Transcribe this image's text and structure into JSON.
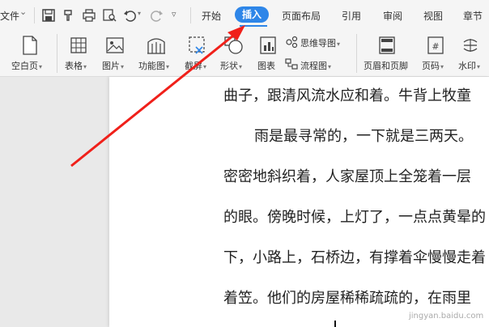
{
  "menu": {
    "file_label": "文件",
    "tabs": [
      {
        "label": "开始"
      },
      {
        "label": "插入"
      },
      {
        "label": "页面布局"
      },
      {
        "label": "引用"
      },
      {
        "label": "审阅"
      },
      {
        "label": "视图"
      },
      {
        "label": "章节"
      }
    ]
  },
  "ribbon": {
    "blank_page": "空白页",
    "table": "表格",
    "picture": "图片",
    "function_chart": "功能图",
    "screenshot": "截屏",
    "shape": "形状",
    "chart": "图表",
    "mindmap": "思维导图",
    "flowchart": "流程图",
    "header_footer": "页眉和页脚",
    "page_number": "页码",
    "watermark": "水印"
  },
  "document": {
    "lines": [
      "曲子，跟清风流水应和着。牛背上牧童",
      "雨是最寻常的，一下就是三两天。",
      "密密地斜织着，人家屋顶上全笼着一层",
      "的眼。傍晚时候，上灯了，一点点黄晕的",
      "下，小路上，石桥边，有撑着伞慢慢走着",
      "着笠。他们的房屋稀稀疏疏的，在雨里"
    ]
  },
  "watermark_text": "jingyan.baidu.com",
  "colors": {
    "accent": "#2e86e8",
    "arrow": "#f0201a"
  }
}
